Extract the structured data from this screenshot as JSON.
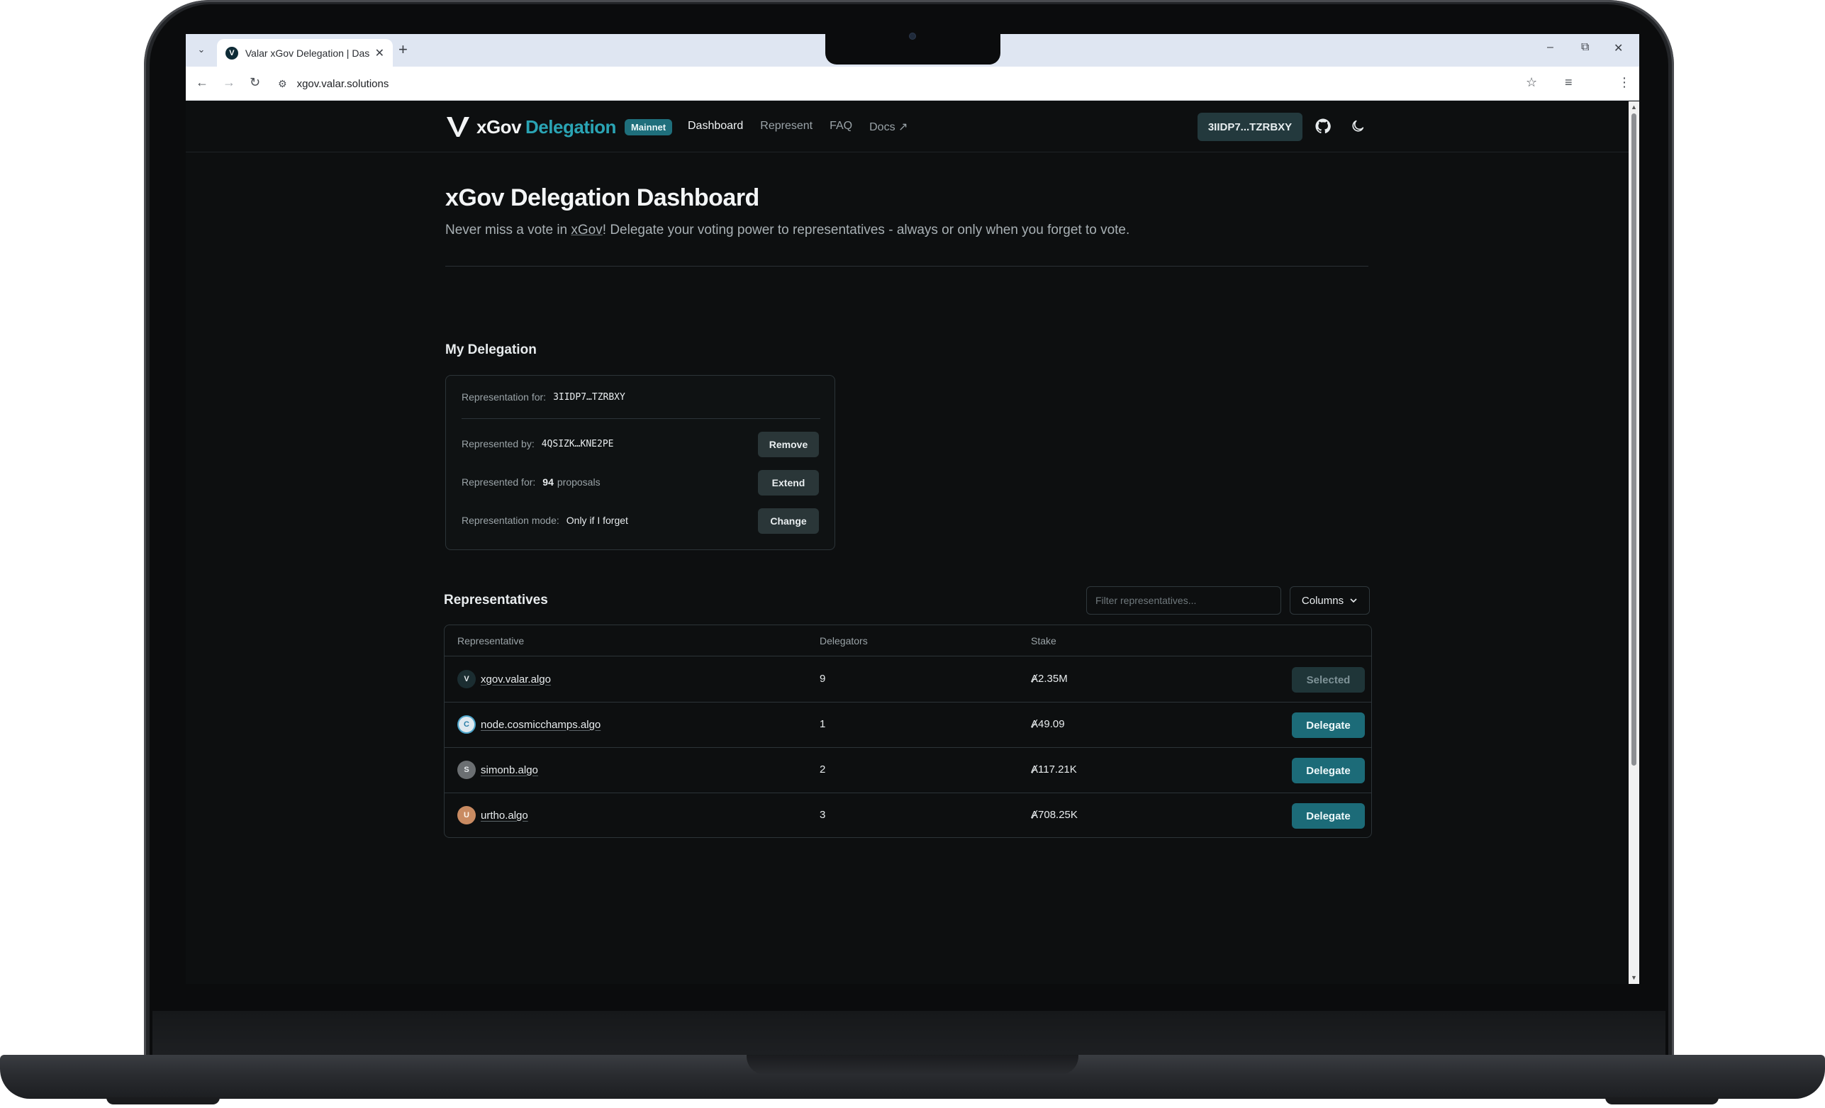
{
  "browser": {
    "tab_title": "Valar xGov Delegation | Dashbo",
    "url": "xgov.valar.solutions"
  },
  "header": {
    "logo_primary": "xGov",
    "logo_secondary": "Delegation",
    "network_badge": "Mainnet",
    "nav": [
      {
        "label": "Dashboard",
        "active": true
      },
      {
        "label": "Represent",
        "active": false
      },
      {
        "label": "FAQ",
        "active": false
      },
      {
        "label": "Docs ↗",
        "active": false
      }
    ],
    "wallet_address": "3IIDP7...TZRBXY"
  },
  "hero": {
    "title": "xGov Delegation Dashboard",
    "subtitle_pre": "Never miss a vote in ",
    "subtitle_link": "xGov",
    "subtitle_post": "! Delegate your voting power to representatives - always or only when you forget to vote."
  },
  "my_delegation": {
    "title": "My Delegation",
    "representation_for_label": "Representation for:",
    "representation_for_value": "3IIDP7…TZRBXY",
    "represented_by_label": "Represented by:",
    "represented_by_value": "4QSIZK…KNE2PE",
    "remove_label": "Remove",
    "represented_for_label": "Represented for:",
    "represented_for_count": "94",
    "represented_for_unit": "proposals",
    "extend_label": "Extend",
    "mode_label": "Representation mode:",
    "mode_value": "Only if I forget",
    "change_label": "Change"
  },
  "representatives": {
    "title": "Representatives",
    "filter_placeholder": "Filter representatives...",
    "columns_label": "Columns",
    "columns": [
      "Representative",
      "Delegators",
      "Stake"
    ],
    "rows": [
      {
        "name": "xgov.valar.algo",
        "delegators": "9",
        "stake": "Ⱥ2.35M",
        "action": "Selected",
        "selected": true
      },
      {
        "name": "node.cosmicchamps.algo",
        "delegators": "1",
        "stake": "Ⱥ49.09",
        "action": "Delegate",
        "selected": false
      },
      {
        "name": "simonb.algo",
        "delegators": "2",
        "stake": "Ⱥ117.21K",
        "action": "Delegate",
        "selected": false
      },
      {
        "name": "urtho.algo",
        "delegators": "3",
        "stake": "Ⱥ708.25K",
        "action": "Delegate",
        "selected": false
      }
    ]
  },
  "colors": {
    "accent": "#2aa4b4",
    "button_primary": "#1c6b78",
    "background": "#0d0f10"
  }
}
